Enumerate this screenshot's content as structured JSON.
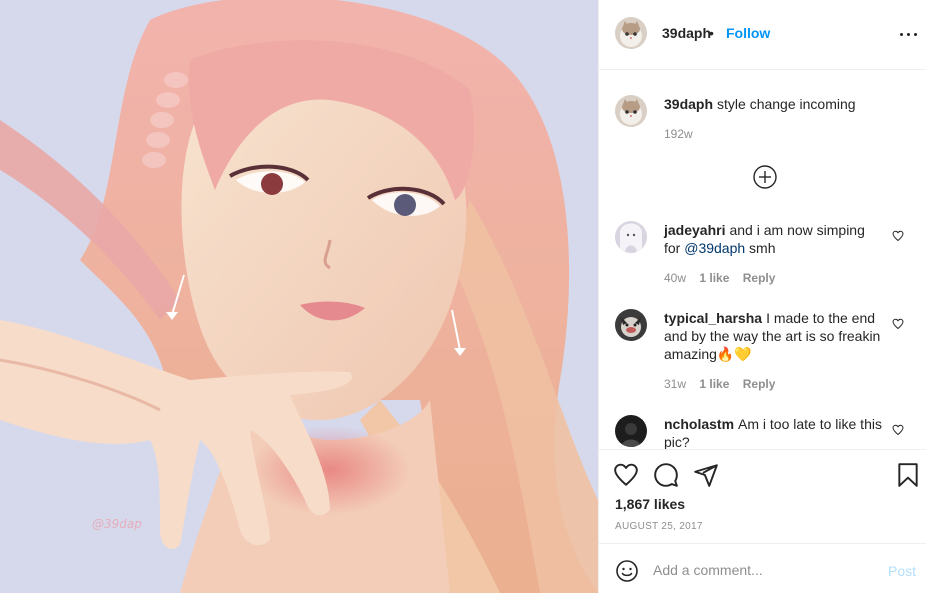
{
  "artwork": {
    "watermark": "@39dap",
    "colors": {
      "background": "#d6d9ec",
      "hair": "#eda7a4",
      "skin": "#f6dcc7"
    }
  },
  "header": {
    "username": "39daph",
    "separator": "•",
    "follow_label": "Follow",
    "more_icon": "more-options-icon"
  },
  "caption": {
    "username": "39daph",
    "text": "style change incoming",
    "time": "192w"
  },
  "load_more_icon": "plus-circle-icon",
  "comments": [
    {
      "username": "jadeyahri",
      "text_before": "and i am now simping for ",
      "mention": "@39daph",
      "text_after": " smh",
      "time": "40w",
      "likes": "1 like",
      "reply": "Reply"
    },
    {
      "username": "typical_harsha",
      "text": "I made to the end and by the way the art is so freakin amazing🔥💛",
      "time": "31w",
      "likes": "1 like",
      "reply": "Reply"
    },
    {
      "username": "ncholastm",
      "text": "Am i too late to like this pic?"
    }
  ],
  "actions": {
    "likes": "1,867 likes",
    "date": "AUGUST 25, 2017"
  },
  "add_comment": {
    "placeholder": "Add a comment...",
    "post_label": "Post"
  },
  "colors": {
    "accent": "#0095f6",
    "post_disabled": "#b2dffc",
    "muted": "#8e8e8e"
  }
}
